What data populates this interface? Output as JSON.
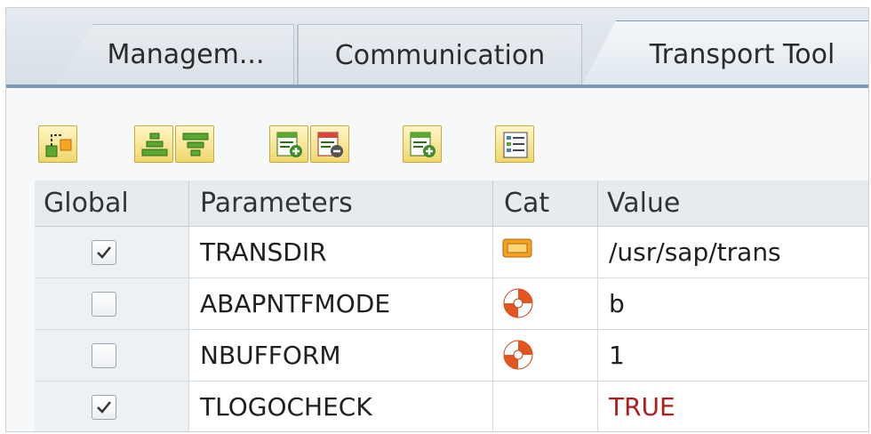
{
  "tabs": [
    {
      "label": "Managem...",
      "active": false
    },
    {
      "label": "Communication",
      "active": false
    },
    {
      "label": "Transport Tool",
      "active": true
    }
  ],
  "toolbar": {
    "buttons": [
      {
        "icon": "hierarchy-icon"
      },
      {
        "icon": "sort-ascending-icon"
      },
      {
        "icon": "sort-descending-icon"
      },
      {
        "icon": "insert-row-icon"
      },
      {
        "icon": "delete-row-icon"
      },
      {
        "icon": "append-row-icon"
      },
      {
        "icon": "details-list-icon"
      }
    ]
  },
  "table": {
    "columns": [
      "Global",
      "Parameters",
      "Cat",
      "Value"
    ],
    "rows": [
      {
        "global": true,
        "parameter": "TRANSDIR",
        "cat": "path-icon",
        "value": "/usr/sap/trans",
        "value_color": "#1f1f1f"
      },
      {
        "global": false,
        "parameter": "ABAPNTFMODE",
        "cat": "lifebuoy-icon",
        "value": "b",
        "value_color": "#1f1f1f"
      },
      {
        "global": false,
        "parameter": "NBUFFORM",
        "cat": "lifebuoy-icon",
        "value": "1",
        "value_color": "#1f1f1f"
      },
      {
        "global": true,
        "parameter": "TLOGOCHECK",
        "cat": "",
        "value": "TRUE",
        "value_color": "#b31b1b"
      }
    ]
  },
  "colors": {
    "accent": "#7c9bb8",
    "toolbar_button": "#f1d66c",
    "lifebuoy": "#e2571f"
  }
}
